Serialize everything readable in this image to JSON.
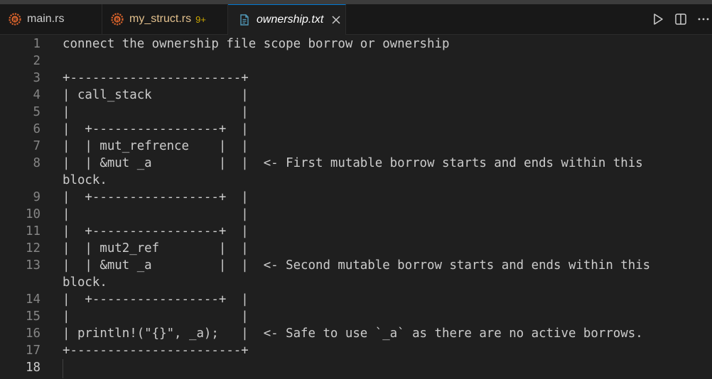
{
  "tabs": [
    {
      "label": "main.rs",
      "icon": "rust-icon",
      "color": "#cccccc"
    },
    {
      "label": "my_struct.rs",
      "icon": "rust-icon",
      "color": "#e2c08d",
      "badge": "9+"
    },
    {
      "label": "ownership.txt",
      "icon": "file-text-icon",
      "color": "#ffffff",
      "active": true
    }
  ],
  "actions": [
    "run-icon",
    "split-editor-icon",
    "more-icon"
  ],
  "editor": {
    "lines": [
      {
        "num": "1",
        "text": "connect the ownership file scope borrow or ownership"
      },
      {
        "num": "2",
        "text": ""
      },
      {
        "num": "3",
        "text": "+-----------------------+"
      },
      {
        "num": "4",
        "text": "| call_stack            |"
      },
      {
        "num": "5",
        "text": "|                       |"
      },
      {
        "num": "6",
        "text": "|  +-----------------+  |"
      },
      {
        "num": "7",
        "text": "|  | mut_refrence    |  |"
      },
      {
        "num": "8",
        "text": "|  | &mut _a         |  |  <- First mutable borrow starts and ends within this"
      },
      {
        "num": "",
        "text": "block."
      },
      {
        "num": "9",
        "text": "|  +-----------------+  |"
      },
      {
        "num": "10",
        "text": "|                       |"
      },
      {
        "num": "11",
        "text": "|  +-----------------+  |"
      },
      {
        "num": "12",
        "text": "|  | mut2_ref        |  |"
      },
      {
        "num": "13",
        "text": "|  | &mut _a         |  |  <- Second mutable borrow starts and ends within this"
      },
      {
        "num": "",
        "text": "block."
      },
      {
        "num": "14",
        "text": "|  +-----------------+  |"
      },
      {
        "num": "15",
        "text": "|                       |"
      },
      {
        "num": "16",
        "text": "| println!(\"{}\", _a);   |  <- Safe to use `_a` as there are no active borrows."
      },
      {
        "num": "17",
        "text": "+-----------------------+"
      },
      {
        "num": "18",
        "text": ""
      }
    ]
  }
}
